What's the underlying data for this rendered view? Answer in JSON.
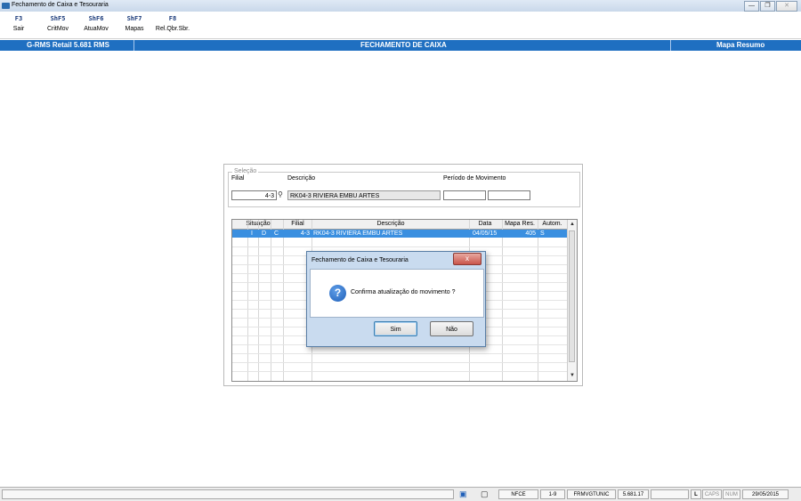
{
  "window": {
    "title": "Fechamento de Caixa e Tesouraria",
    "controls": {
      "minimize": "—",
      "restore": "❐",
      "close": "✕"
    }
  },
  "toolbar": {
    "items": [
      {
        "key": "F3",
        "label": "Sair"
      },
      {
        "key": "ShF5",
        "label": "CritMov"
      },
      {
        "key": "ShF6",
        "label": "AtuaMov"
      },
      {
        "key": "ShF7",
        "label": "Mapas"
      },
      {
        "key": "F8",
        "label": "Rel.Qbr.Sbr."
      }
    ]
  },
  "header": {
    "left": "G-RMS Retail 5.681 RMS",
    "center": "FECHAMENTO DE CAIXA",
    "right": "Mapa Resumo",
    "bar_color": "#1f6fc1"
  },
  "selection": {
    "group_title": "Seleção",
    "filial_label": "Filial",
    "filial_value": "4-3",
    "descricao_label": "Descrição",
    "descricao_value": "RK04-3 RIVIERA EMBU ARTES",
    "periodo_label": "Período de Movimento",
    "periodo_from": "",
    "periodo_to": "",
    "search_icon": "binoculars-icon"
  },
  "grid": {
    "columns": [
      "Situação",
      "Filial",
      "Descrição",
      "Data",
      "Mapa Res.",
      "Autom."
    ],
    "rows": [
      {
        "sit1": "I",
        "sit2": "D",
        "sit3": "C",
        "filial": "4-3",
        "descricao": "RK04-3 RIVIERA EMBU ARTES",
        "data": "04/05/15",
        "mapa": "405",
        "autom": "S"
      }
    ],
    "selected_color": "#3a8fe0"
  },
  "dialog": {
    "title": "Fechamento de Caixa e Tesouraria",
    "close": "x",
    "icon": "question-icon",
    "message": "Confirma atualização do movimento ?",
    "yes": "Sim",
    "no": "Não"
  },
  "status": {
    "nfce": "NFCE",
    "page": "1-9",
    "form": "FRMVGTUNIC",
    "version": "5.681.17",
    "l": "L",
    "caps": "CAPS",
    "num": "NUM",
    "date": "29/05/2015"
  }
}
